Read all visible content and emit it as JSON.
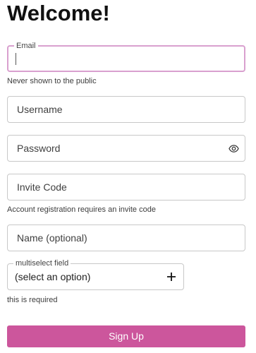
{
  "page": {
    "title": "Welcome!"
  },
  "form": {
    "email": {
      "label": "Email",
      "value": "",
      "helper": "Never shown to the public"
    },
    "username": {
      "placeholder": "Username"
    },
    "password": {
      "placeholder": "Password",
      "toggle_icon": "eye-icon"
    },
    "invite_code": {
      "placeholder": "Invite Code",
      "helper": "Account registration requires an invite code"
    },
    "name": {
      "placeholder": "Name (optional)"
    },
    "multiselect": {
      "label": "multiselect field",
      "value": "(select an option)",
      "add_icon": "plus-icon",
      "helper": "this is required"
    },
    "submit_label": "Sign Up"
  },
  "colors": {
    "accent": "#cc569c",
    "focus_border": "#d9a0cf",
    "border": "#c8c8c8"
  }
}
